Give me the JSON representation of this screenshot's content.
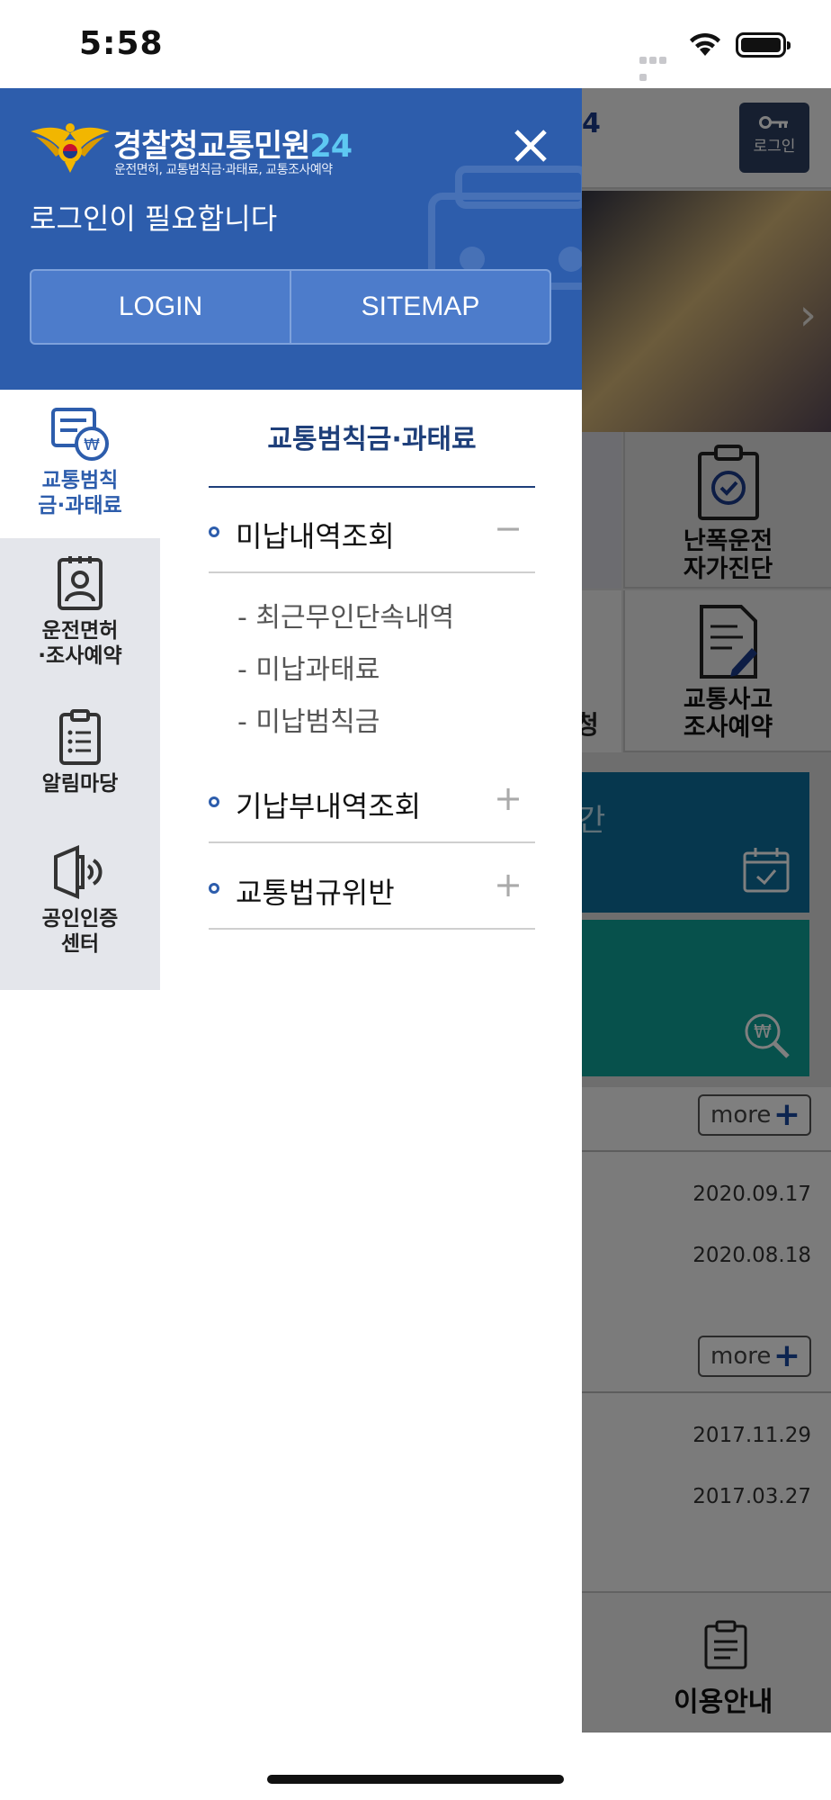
{
  "status_bar": {
    "time": "5:58"
  },
  "background_app": {
    "header_fragment": "4",
    "login_button": "로그인",
    "tiles": [
      {
        "label": "난폭운전\n자가진단"
      },
      {
        "label": "교통사고\n조사예약"
      }
    ],
    "tile_left_fragment": "청",
    "panel_fragment": "간",
    "more_label": "more",
    "dates_1": [
      "2020.09.17",
      "2020.08.18"
    ],
    "dates_2": [
      "2017.11.29",
      "2017.03.27"
    ],
    "footer_label": "이용안내"
  },
  "drawer": {
    "title": "경찰청교통민원",
    "title_suffix": "24",
    "subtitle": "운전면허, 교통범칙금·과태료, 교통조사예약",
    "login_message": "로그인이 필요합니다",
    "login_button": "LOGIN",
    "sitemap_button": "SITEMAP",
    "categories": [
      {
        "label": "교통범칙\n금·과태료",
        "icon": "fine-document-icon",
        "active": true
      },
      {
        "label": "운전면허\n·조사예약",
        "icon": "license-icon",
        "active": false
      },
      {
        "label": "알림마당",
        "icon": "notice-clipboard-icon",
        "active": false
      },
      {
        "label": "공인인증\n센터",
        "icon": "certificate-speaker-icon",
        "active": false
      }
    ],
    "menu_title": "교통범칙금·과태료",
    "menu_items": [
      {
        "label": "미납내역조회",
        "toggle": "−",
        "expanded": true
      },
      {
        "label": "기납부내역조회",
        "toggle": "+",
        "expanded": false
      },
      {
        "label": "교통법규위반",
        "toggle": "+",
        "expanded": false
      }
    ],
    "sub_items": [
      "- 최근무인단속내역",
      "- 미납과태료",
      "- 미납범칙금"
    ]
  }
}
